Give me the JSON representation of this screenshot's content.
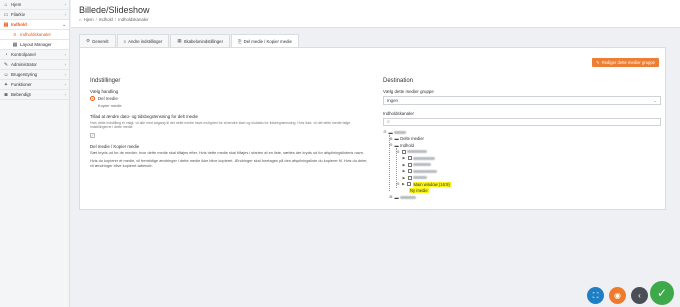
{
  "sidebar": {
    "items": [
      {
        "label": "Hjem",
        "icon": "home-icon",
        "glyph": "⌂",
        "type": "item"
      },
      {
        "label": "Filarkiv",
        "icon": "folder-icon",
        "glyph": "▭",
        "type": "item"
      },
      {
        "label": "Indhold",
        "icon": "file-icon",
        "glyph": "▤",
        "type": "active"
      },
      {
        "label": "Indholdskanaler",
        "icon": "channels-icon",
        "glyph": "≡",
        "type": "sub-current"
      },
      {
        "label": "Layout Manager",
        "icon": "layout-icon",
        "glyph": "▦",
        "type": "sub"
      },
      {
        "label": "Kontrolpanel",
        "icon": "dashboard-icon",
        "glyph": "◔",
        "type": "item"
      },
      {
        "label": "Administrator",
        "icon": "wrench-icon",
        "glyph": "✎",
        "type": "item"
      },
      {
        "label": "Brugerstyring",
        "icon": "users-icon",
        "glyph": "☺",
        "type": "item"
      },
      {
        "label": "Funktioner",
        "icon": "functions-icon",
        "glyph": "✦",
        "type": "item"
      },
      {
        "label": "Bebendigt",
        "icon": "lock-icon",
        "glyph": "◙",
        "type": "item"
      }
    ]
  },
  "header": {
    "title": "Billede/Slideshow",
    "breadcrumb": [
      "Hjem",
      "Indhold",
      "Indholdskanaler"
    ]
  },
  "tabs": [
    {
      "label": "Generelt",
      "icon": "gear-icon",
      "glyph": "⚙",
      "active": false
    },
    {
      "label": "Andre indstillinger",
      "icon": "sliders-icon",
      "glyph": "≡",
      "active": false
    },
    {
      "label": "Skabelonindstillinger",
      "icon": "template-icon",
      "glyph": "▦",
      "active": false
    },
    {
      "label": "Del medie / Kopier medie",
      "icon": "share-icon",
      "glyph": "⎘",
      "active": true
    }
  ],
  "panel": {
    "edit_group_button": "Rediger dette medier gruppe",
    "left": {
      "title": "Indstillinger",
      "handling_label": "Vælg handling",
      "radio_selected": "Del medie",
      "radio_other": "Kopier medie",
      "date_permission_label": "Tillad at ændre dato- og tidsbegrænsning for delt medie",
      "date_permission_help": "Hvis dette indstilling er valgt, vil alle med adgang til det delte medie have mulighed for at ændre start og slutdato for tidsbegrænsning. Hvis ikke, vil det delte medie følge indstillingerne i dette medie.",
      "checkbox_glyph": "✓",
      "share_heading": "Del medie / Kopier medie",
      "share_help": "Sæt kryds ud for de medier, hvor dette medie skal tilføjes efter. Hvis dette medie skal tilføjes i starten af en liste, sættes der kryds ud for afspilningslistens navn.",
      "copy_help": "Hvis du kopierer et medie, vil fremtidige ændringer i dette medie ikke blive kopieret. Ændringer skal foretages på den afspilningsliste du kopierer til. Hvis du deler, vil ændringer blive kopieret løbende."
    },
    "right": {
      "title": "Destination",
      "group_label": "Vælg dette medier gruppe",
      "group_value": "Ingen",
      "channels_label": "Indholdskanaler",
      "search_placeholder": "",
      "tree_delete": "Delte medier",
      "tree_content": "Indhold",
      "tree_highlight": "Main window (16:9)",
      "tree_new": "Ny medie"
    }
  },
  "actions": {
    "fullscreen_glyph": "⛶",
    "preview_glyph": "◉",
    "back_glyph": "‹",
    "save_glyph": "✓"
  }
}
